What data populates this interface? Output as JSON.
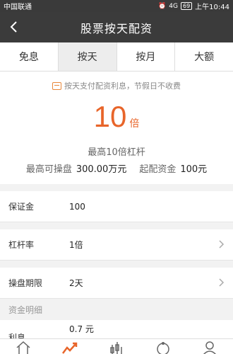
{
  "status_bar": {
    "carrier": "中国联通",
    "signal": "4G",
    "battery": "69",
    "time": "上午10:44"
  },
  "header": {
    "title": "股票按天配资",
    "back_icon": "back-arrow-icon"
  },
  "tabs": [
    {
      "label": "免息",
      "active": false
    },
    {
      "label": "按天",
      "active": true
    },
    {
      "label": "按月",
      "active": false
    },
    {
      "label": "大额",
      "active": false
    }
  ],
  "info": {
    "notice": "按天支付配资利息，节假日不收费",
    "multiplier_value": "10",
    "multiplier_unit": "倍",
    "max_leverage": "最高10倍杠杆",
    "max_trade_label": "最高可操盘",
    "max_trade_value": "300.00万元",
    "min_fund_label": "起配资金",
    "min_fund_value": "100元"
  },
  "form": {
    "margin_label": "保证金",
    "margin_value": "100",
    "leverage_label": "杠杆率",
    "leverage_value": "1倍",
    "period_label": "操盘期限",
    "period_value": "2天"
  },
  "details": {
    "section_title": "资金明细",
    "interest_label": "利息",
    "interest_value": "0.7 元"
  },
  "bottom_nav": [
    "home-icon",
    "chart-trend-icon",
    "candlestick-icon",
    "discover-icon",
    "user-icon"
  ],
  "colors": {
    "accent": "#e8652a",
    "header_bg": "#3b3b3b"
  }
}
